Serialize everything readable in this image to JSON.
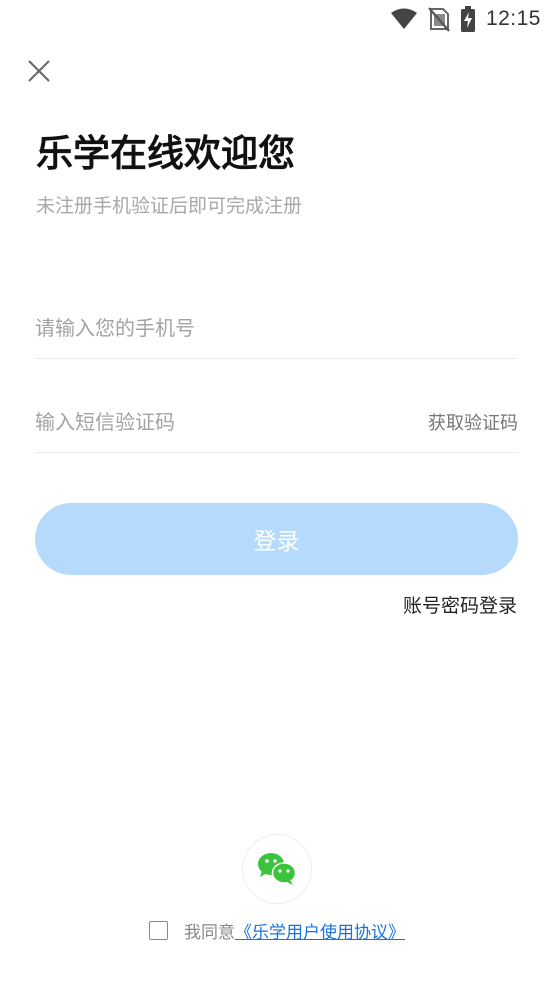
{
  "status_bar": {
    "time": "12:15",
    "icons": [
      "wifi-icon",
      "no-sim-icon",
      "battery-charging-icon"
    ]
  },
  "header": {
    "close_icon": "close-icon",
    "title": "乐学在线欢迎您",
    "subtitle": "未注册手机验证后即可完成注册"
  },
  "form": {
    "phone_placeholder": "请输入您的手机号",
    "phone_value": "",
    "code_placeholder": "输入短信验证码",
    "code_value": "",
    "get_code_label": "获取验证码",
    "login_label": "登录",
    "password_login_label": "账号密码登录"
  },
  "footer": {
    "wechat_icon": "wechat-icon",
    "agree_prefix": "我同意",
    "agreement_link": "《乐学用户使用协议》",
    "agree_checked": false
  },
  "colors": {
    "login_button_bg": "#b6dafb",
    "link": "#1a73d9",
    "wechat_green": "#3bc43b"
  }
}
